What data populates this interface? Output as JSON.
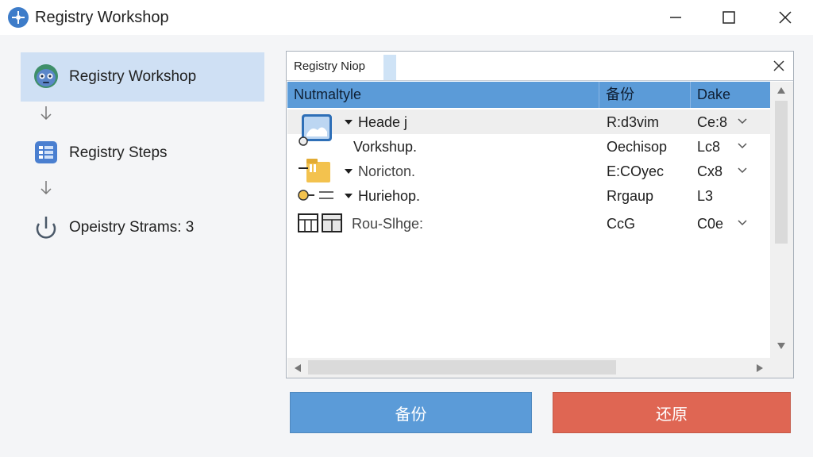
{
  "window": {
    "title": "Registry Workshop",
    "icon": "app-logo-icon",
    "controls": [
      "minimize-icon",
      "maximize-icon",
      "close-icon"
    ]
  },
  "sidebar": {
    "items": [
      {
        "label": "Registry Workshop",
        "icon": "registry-mask-icon",
        "active": true
      },
      {
        "label": "Registry Steps",
        "icon": "registry-grid-icon",
        "active": false
      },
      {
        "label": "Opeistry Strams: 3",
        "icon": "power-icon",
        "active": false
      }
    ]
  },
  "panel": {
    "tab_label": "Registry Niop",
    "columns": [
      "Nutmaltyle",
      "备份",
      "Dake"
    ],
    "rows": [
      {
        "name": "Heade j",
        "col2": "R:d3vim",
        "col3": "Ce:8",
        "caret": true,
        "chevron": true,
        "icon": "picture-folder-icon"
      },
      {
        "name": "Vorkshup.",
        "col2": "Oechisop",
        "col3": "Lc8",
        "caret": false,
        "chevron": true,
        "icon": ""
      },
      {
        "name": "Noricton.",
        "col2": "E:COyec",
        "col3": "Cx8",
        "caret": true,
        "chevron": true,
        "icon": "folder-icon"
      },
      {
        "name": "Huriehop.",
        "col2": "Rrgaup",
        "col3": "L3",
        "caret": true,
        "chevron": false,
        "icon": "key-icon"
      },
      {
        "name": "Rou-Slhge:",
        "col2": "CcG",
        "col3": "C0e",
        "caret": false,
        "chevron": true,
        "icon": "grid-icon"
      }
    ]
  },
  "buttons": {
    "backup": "备份",
    "restore": "还原"
  },
  "colors": {
    "accent": "#5b9bd8",
    "danger": "#df6653",
    "selection": "#cfe0f4"
  }
}
